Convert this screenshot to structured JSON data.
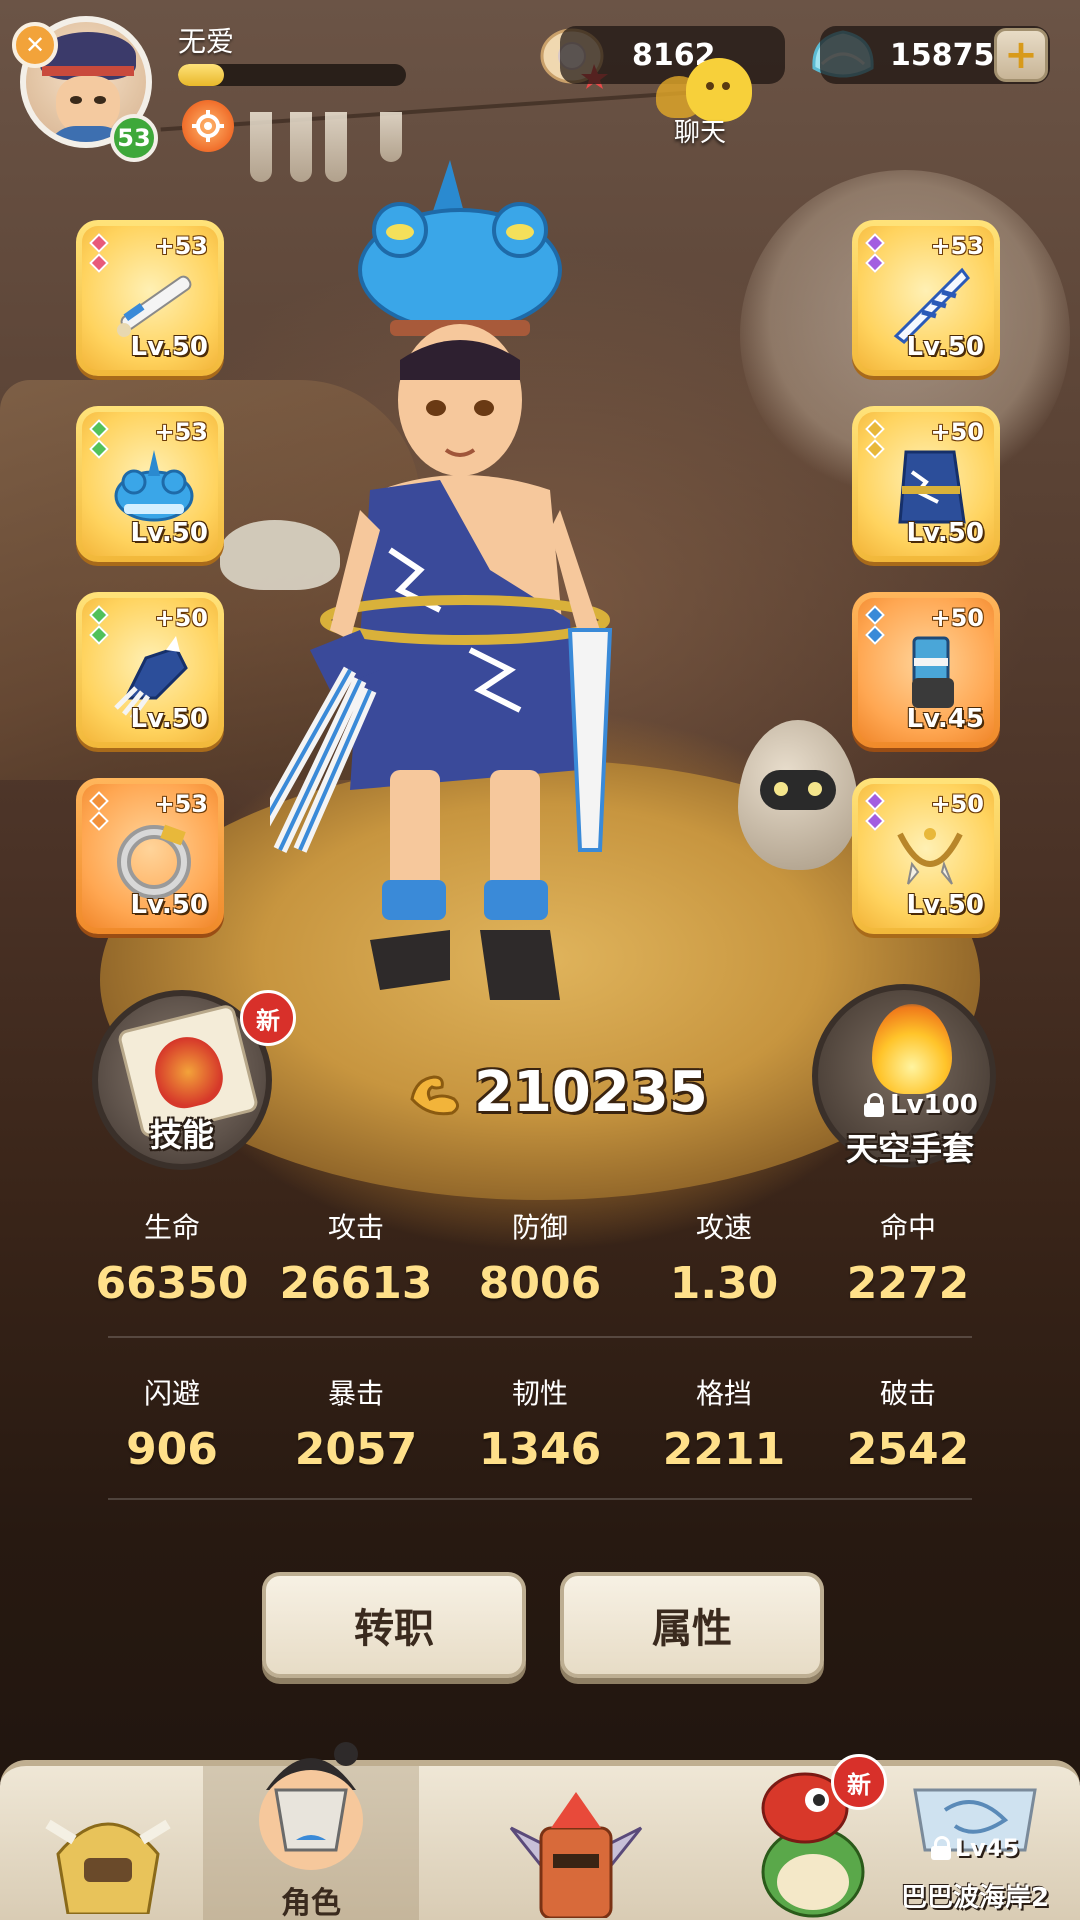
{
  "player": {
    "name": "无爱",
    "level": "53",
    "exp_fraction": 0.2
  },
  "currency": {
    "pearls": "8162",
    "gems": "158751"
  },
  "chat": {
    "label": "聊天"
  },
  "equipment": {
    "left": [
      {
        "enhance": "+53",
        "level": "Lv.50",
        "item_icon": "bone-sword-icon",
        "frame": "gold"
      },
      {
        "enhance": "+53",
        "level": "Lv.50",
        "item_icon": "frog-helmet-icon",
        "frame": "gold"
      },
      {
        "enhance": "+50",
        "level": "Lv.50",
        "item_icon": "claw-gauntlet-icon",
        "frame": "gold"
      },
      {
        "enhance": "+53",
        "level": "Lv.50",
        "item_icon": "stone-ring-icon",
        "frame": "orange"
      }
    ],
    "right": [
      {
        "enhance": "+53",
        "level": "Lv.50",
        "item_icon": "ice-blade-icon",
        "frame": "gold"
      },
      {
        "enhance": "+50",
        "level": "Lv.50",
        "item_icon": "lightning-robe-icon",
        "frame": "gold"
      },
      {
        "enhance": "+50",
        "level": "Lv.45",
        "item_icon": "boots-icon",
        "frame": "orange"
      },
      {
        "enhance": "+50",
        "level": "Lv.50",
        "item_icon": "fang-necklace-icon",
        "frame": "gold"
      }
    ]
  },
  "skill": {
    "label": "技能",
    "badge": "新"
  },
  "gloves": {
    "lock_level": "Lv100",
    "label": "天空手套"
  },
  "power": {
    "value": "210235"
  },
  "stats_row1": [
    {
      "label": "生命",
      "value": "66350"
    },
    {
      "label": "攻击",
      "value": "26613"
    },
    {
      "label": "防御",
      "value": "8006"
    },
    {
      "label": "攻速",
      "value": "1.30"
    },
    {
      "label": "命中",
      "value": "2272"
    }
  ],
  "stats_row2": [
    {
      "label": "闪避",
      "value": "906"
    },
    {
      "label": "暴击",
      "value": "2057"
    },
    {
      "label": "韧性",
      "value": "1346"
    },
    {
      "label": "格挡",
      "value": "2211"
    },
    {
      "label": "破击",
      "value": "2542"
    }
  ],
  "actions": {
    "job_change": "转职",
    "attributes": "属性"
  },
  "nav": {
    "tabs": [
      {
        "icon": "yeti-icon",
        "label": ""
      },
      {
        "icon": "character-icon",
        "label": "角色"
      },
      {
        "icon": "totem-icon",
        "label": ""
      },
      {
        "icon": "dino-pet-icon",
        "label": "",
        "badge": "新"
      },
      {
        "icon": "map-icon",
        "label": "巴巴波海岸2",
        "lock_level": "Lv45"
      }
    ]
  },
  "colors": {
    "stat_value": "#ffe08a",
    "new_badge": "#d8302a",
    "level_badge": "#3ea83a",
    "slot_gold": "#f2b83a",
    "slot_orange": "#f08a2a"
  }
}
